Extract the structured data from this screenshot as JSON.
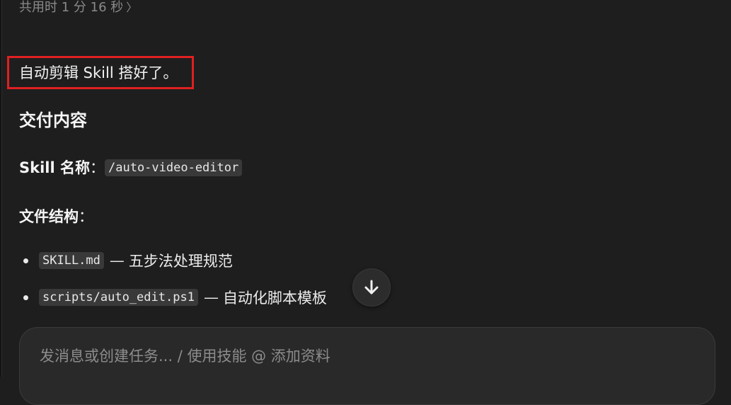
{
  "status": {
    "elapsed": "共用时 1 分 16 秒",
    "chevron": "〉"
  },
  "message": {
    "summary": "自动剪辑 Skill 搭好了。",
    "deliverables_heading": "交付内容",
    "skill_name_label": "Skill 名称",
    "skill_name_colon": "：",
    "skill_name_value": "/auto-video-editor",
    "file_structure_label": "文件结构",
    "file_structure_colon": "：",
    "files": [
      {
        "code": "SKILL.md",
        "dash": "—",
        "desc": "五步法处理规范"
      },
      {
        "code": "scripts/auto_edit.ps1",
        "dash": "—",
        "desc": "自动化脚本模板"
      }
    ]
  },
  "composer": {
    "placeholder": "发消息或创建任务... / 使用技能 @ 添加资料"
  },
  "icons": {
    "scroll_down": "arrow-down-icon"
  },
  "colors": {
    "background": "#1f1e1f",
    "highlight": "#e02020",
    "code_bg": "#3a393a"
  }
}
